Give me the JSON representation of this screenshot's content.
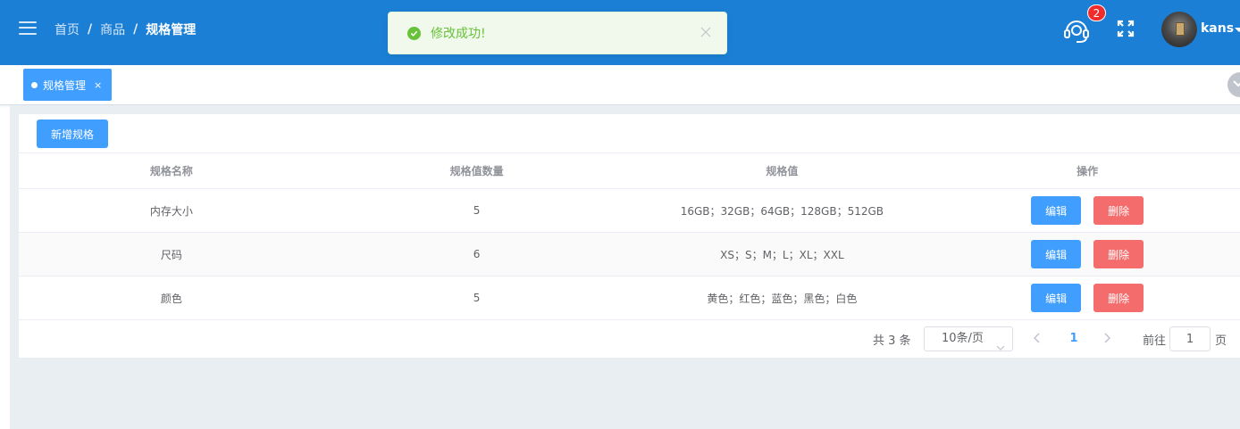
{
  "breadcrumb": {
    "items": [
      "首页",
      "商品",
      "规格管理"
    ],
    "separator": "/"
  },
  "toast": {
    "message": "修改成功!"
  },
  "header": {
    "notification_count": "2",
    "username": "kans"
  },
  "tabs": [
    {
      "label": "规格管理",
      "close": "×"
    }
  ],
  "toolbar": {
    "add_label": "新增规格"
  },
  "table": {
    "headers": [
      "规格名称",
      "规格值数量",
      "规格值",
      "操作"
    ],
    "rows": [
      {
        "name": "内存大小",
        "count": "5",
        "values": "16GB；32GB；64GB；128GB；512GB"
      },
      {
        "name": "尺码",
        "count": "6",
        "values": "XS；S；M；L；XL；XXL"
      },
      {
        "name": "颜色",
        "count": "5",
        "values": "黄色；红色；蓝色；黑色；白色"
      }
    ],
    "edit_label": "编辑",
    "delete_label": "删除"
  },
  "pagination": {
    "total_text": "共 3 条",
    "page_size": "10条/页",
    "current_page": "1",
    "goto_label": "前往",
    "goto_value": "1",
    "page_suffix": "页"
  },
  "colors": {
    "header_bg": "#1c7fd6",
    "primary": "#409eff",
    "danger": "#f56c6c",
    "success": "#67c23a"
  },
  "icons": {
    "menu": "hamburger-icon",
    "support": "headset-icon",
    "fullscreen": "fullscreen-icon",
    "toast": "check-circle-icon",
    "toast_close": "close-icon"
  }
}
